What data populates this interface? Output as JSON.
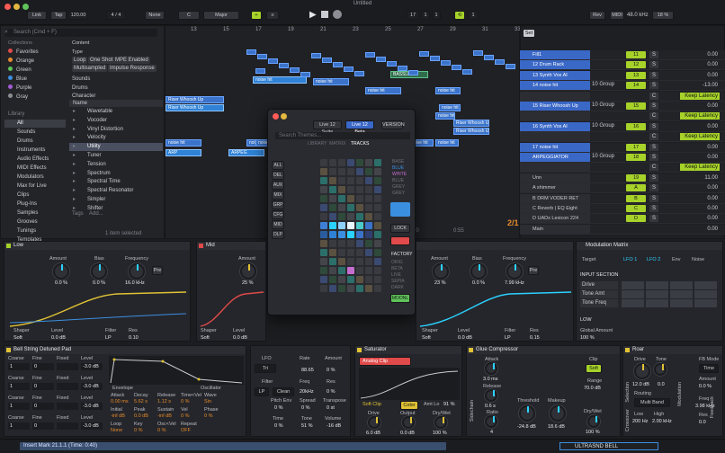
{
  "window": {
    "title": "Untitled"
  },
  "toolbar": {
    "link": "Link",
    "tap": "Tap",
    "tempo": "120.00",
    "signature": "4 / 4",
    "none": "None",
    "key": "C",
    "scale": "Major",
    "position": "17",
    "pos2": "1",
    "pos3": "1",
    "loop_len": "1",
    "rev": "Rev",
    "midi": "MIDI",
    "sample_rate": "48.0 kHz",
    "cpu": "18 %"
  },
  "browser": {
    "search_placeholder": "Search (Cmd + F)",
    "collections_title": "Collections",
    "collections": [
      {
        "label": "Favorites",
        "color": "#e04a4a"
      },
      {
        "label": "Orange",
        "color": "#e58a2b"
      },
      {
        "label": "Green",
        "color": "#5fc35a"
      },
      {
        "label": "Blue",
        "color": "#3b8fe0"
      },
      {
        "label": "Purple",
        "color": "#a35bd6"
      },
      {
        "label": "Gray",
        "color": "#8b8e94"
      }
    ],
    "library_title": "Library",
    "library": [
      "All",
      "Sounds",
      "Drums",
      "Instruments",
      "Audio Effects",
      "MIDI Effects",
      "Modulators",
      "Max for Live",
      "Clips",
      "Plug-Ins",
      "Samples",
      "Grooves",
      "Tunings",
      "Templates"
    ],
    "filters": {
      "content": "Content",
      "type": "Type",
      "tags": [
        "Loop",
        "One Shot",
        "MPE Enabled",
        "Multisampled",
        "Impulse Response"
      ],
      "sounds": "Sounds",
      "drums": "Drums",
      "character": "Character"
    },
    "name_header": "Name",
    "items": [
      "Wavetable",
      "Vocoder",
      "Vinyl Distortion",
      "Velocity",
      "Utility",
      "Tuner",
      "Tension",
      "Spectrum",
      "Spectral Time",
      "Spectral Resonator",
      "Simpler",
      "Shifter"
    ],
    "tags_label": "Tags",
    "add": "Add...",
    "status": "1 item selected"
  },
  "arrangement": {
    "bars": [
      "13",
      "15",
      "17",
      "19",
      "21",
      "23",
      "25",
      "27",
      "29",
      "31",
      "33"
    ],
    "times": [
      "0:20",
      "0:40",
      "0:50",
      "0:55"
    ],
    "clips": [
      "noise hit",
      "noise hit",
      "BASSLINE",
      "noise hit",
      "noise hit",
      "noise hit",
      "Riser Whoosh Up",
      "Riser Whoosh Up",
      "noise hit",
      "noise hit",
      "noise hit",
      "noise hit",
      "noise hit",
      "Riser Whoosh Up",
      "Riser Whoosh Up",
      "noise hit",
      "noise hit",
      "noise hit",
      "ARP",
      "ARPEG"
    ],
    "ratio": "2/1"
  },
  "tracks": {
    "set_label": "Set",
    "rows": [
      {
        "name": "Fill1",
        "vol": "11",
        "send": "S",
        "val": "0.00"
      },
      {
        "name": "12 Drum Rack",
        "vol": "12",
        "send": "S",
        "val": "0.00"
      },
      {
        "name": "13 Synth Vox AI",
        "vol": "13",
        "send": "S",
        "val": "0.00"
      },
      {
        "name": "14 noise hit",
        "vol": "14",
        "send": "S",
        "val": "-13.00"
      },
      {
        "name": "",
        "vol": "",
        "send": "C",
        "val": "Keep Latency"
      },
      {
        "name": "15 Riser Whoosh Up",
        "vol": "15",
        "send": "S",
        "val": "0.00"
      },
      {
        "name": "",
        "vol": "",
        "send": "C",
        "val": "Keep Latency"
      },
      {
        "name": "16 Synth Vox AI",
        "vol": "16",
        "send": "S",
        "val": "0.00"
      },
      {
        "name": "",
        "vol": "",
        "send": "C",
        "val": "Keep Latency"
      },
      {
        "name": "17 noise hit",
        "vol": "17",
        "send": "S",
        "val": "0.00"
      },
      {
        "name": "ARPEGGIATOR",
        "vol": "18",
        "send": "S",
        "val": "0.00"
      },
      {
        "name": "",
        "vol": "",
        "send": "C",
        "val": "Keep Latency"
      },
      {
        "name": "Unn",
        "vol": "19",
        "send": "S",
        "val": "11.00"
      },
      {
        "name": "A shimmer",
        "vol": "A",
        "send": "S",
        "val": "0.00"
      },
      {
        "name": "B DRM VODER RET",
        "vol": "B",
        "send": "S",
        "val": "0.00"
      },
      {
        "name": "C Reverb | EQ Eight",
        "vol": "C",
        "send": "S",
        "val": "0.00"
      },
      {
        "name": "D UADx Lexicon 224 Digital",
        "vol": "D",
        "send": "S",
        "val": "0.00"
      },
      {
        "name": "Main",
        "vol": "",
        "send": "",
        "val": "0.00"
      }
    ],
    "group": "10 Group",
    "in": "In",
    "auto": "Auto",
    "off": "Off"
  },
  "popup": {
    "tabs": [
      "Live 12 Suite",
      "Live 12 Beta"
    ],
    "version": "VERSION",
    "search_placeholder": "Search Themes...",
    "categories": [
      "LIBRARY",
      "MATRIX",
      "TRACKS"
    ],
    "left_buttons": [
      "ALL",
      "DEL",
      "AUX",
      "MIX",
      "GRP",
      "CFG",
      "MID",
      "DLP"
    ],
    "right_labels": [
      "BASE",
      "BLUE",
      "WHITE",
      "BLUE",
      "GREY",
      "GREY"
    ],
    "lock": "LOCK",
    "factory": "FACTORY",
    "mode_labels": [
      "ORIG",
      "BETA",
      "LIVE",
      "SEPIA",
      "DARK"
    ],
    "moonlight": "MOONL"
  },
  "devices": {
    "low": {
      "title": "Low",
      "amount_l": "Amount",
      "amount": "0.0 %",
      "bias_l": "Bias",
      "bias": "0.0 %",
      "freq_l": "Frequency",
      "freq": "16.0 kHz",
      "pre": "Pre",
      "shaper": "Shaper",
      "shaper_v": "Soft",
      "level": "Level",
      "level_v": "0.0 dB",
      "filter": "Filter",
      "lp": "LP",
      "res": "Res",
      "res_v": "0.10"
    },
    "mid": {
      "title": "Mid",
      "amount_l": "Amount",
      "amount": "25 %",
      "bias_l": "Bias",
      "bias": "0.0 %",
      "freq_l": "Frequency",
      "freq": "7.99 kHz",
      "pre": "Pre",
      "shaper": "Shaper",
      "shaper_v": "Soft",
      "level": "Level",
      "level_v": "0.0 dB",
      "filter": "Filter",
      "lp": "LP",
      "res": "Res",
      "res_v": "0.10"
    },
    "high": {
      "amount_l": "Amount",
      "amount": "23 %",
      "bias_l": "Bias",
      "bias": "0.0 %",
      "freq_l": "Frequency",
      "freq": "7.99 kHz",
      "pre": "Pre",
      "shaper": "Shaper",
      "shaper_v": "Soft",
      "level": "Level",
      "level_v": "0.0 dB",
      "filter": "Filter",
      "lp": "LP",
      "res": "Res",
      "res_v": "0.15"
    },
    "modmatrix": {
      "title": "Modulation Matrix",
      "target": "Target",
      "lfo1": "LFO 1",
      "lfo2": "LFO 2",
      "env": "Env",
      "noise": "Noise",
      "input_section": "INPUT SECTION",
      "rows": [
        "Drive",
        "Tone Amt",
        "Tone Freq"
      ],
      "low": "LOW",
      "global": "Global Amount",
      "global_v": "100 %"
    },
    "synth": {
      "title": "Bell String Detuned Pad",
      "osc_labels": [
        "Coarse",
        "Fine",
        "Fixed",
        "Level"
      ],
      "osc_vals": [
        "1",
        "0",
        "",
        "-3.0 dB"
      ],
      "env": "Envelope",
      "osc": "Oscillator",
      "attack": "Attack",
      "decay": "Decay",
      "release": "Release",
      "time_vel": "Time<Vel",
      "wave": "Wave",
      "att_v": "0.00 ms",
      "dec_v": "5.62 s",
      "rel_v": "1.12 s",
      "tv_v": "0 %",
      "wave_v": "Sin",
      "initial": "Initial",
      "peak": "Peak",
      "sustain": "Sustain",
      "vel": "Vel",
      "ini_v": "-inf dB",
      "peak_v": "0.0 dB",
      "sus_v": "-inf dB",
      "vel_v": "0 %",
      "loop": "Loop",
      "loop_v": "None",
      "key": "Key",
      "key_v": "0 %",
      "phase": "Phase",
      "phase_v": "0 %",
      "osc_vel": "Osc<Vel",
      "osc_vel_v": "0 %",
      "repeat": "Repeat",
      "repeat_v": "OFF"
    },
    "lfo": {
      "title": "LFO",
      "tri": "Tri",
      "rate": "Rate",
      "rate_v": "88.65",
      "amount": "Amount",
      "amount_v": "0 %",
      "filter": "Filter",
      "lp": "LP",
      "clean": "Clean",
      "freq": "Freq",
      "freq_v": "20kHz",
      "res": "Res",
      "res_v": "0 %",
      "pitch_env": "Pitch Env",
      "pitch_v": "0 %",
      "spread": "Spread",
      "spread_v": "0 %",
      "transpose": "Transpose",
      "trans_v": "0 st",
      "time": "Time",
      "time_v": "0 %",
      "tone": "Tone",
      "tone_v": "51 %",
      "volume": "Volume",
      "volume_v": "-16 dB"
    },
    "saturator": {
      "title": "Saturator",
      "mode": "Analog Clip",
      "soft_clip": "Soft Clip",
      "color": "Color",
      "amt": "Amt Lo",
      "amt_v": "91 %",
      "drive": "Drive",
      "drive_v": "6.0 dB",
      "output": "Output",
      "output_v": "0.0 dB",
      "drywet": "Dry/Wet",
      "drywet_v": "100 %"
    },
    "glue": {
      "title": "Glue Compressor",
      "attack": "Attack",
      "attack_v": "3.0 ms",
      "release": "Release",
      "release_v": "0.6 s",
      "ratio": "Ratio",
      "ratio_v": "4",
      "threshold": "Threshold",
      "thr_v": "-24.8 dB",
      "makeup": "Makeup",
      "mk_v": "18.6 dB",
      "range": "Range",
      "range_v": "70.0 dB",
      "clip": "Clip",
      "soft": "Soft",
      "drywet": "Dry/Wet",
      "dw_v": "100 %",
      "sidechain": "Sidechain"
    },
    "roar": {
      "title": "Roar",
      "drive": "Drive",
      "drive_v": "12.0 dB",
      "tone": "Tone",
      "tone_v": "0.0",
      "routing": "Routing",
      "routing_v": "Multi Band",
      "low": "Low",
      "high": "High",
      "low_v": "200 Hz",
      "high_v": "2.00 kHz",
      "fb_mode": "FB Mode",
      "fb_v": "Time",
      "amount": "Amount",
      "amt_v": "0.0 %",
      "freq": "Freq",
      "freq_v": "3.98 kHz",
      "res": "Res",
      "res_v": "0.0",
      "crossover": "Crossover",
      "selection": "Selection",
      "modulation": "Modulation",
      "feedback": "Feedback"
    }
  },
  "status": {
    "insert": "Insert Mark 21.1.1 (Time: 0:40)",
    "track": "ULTRASND BELL"
  }
}
